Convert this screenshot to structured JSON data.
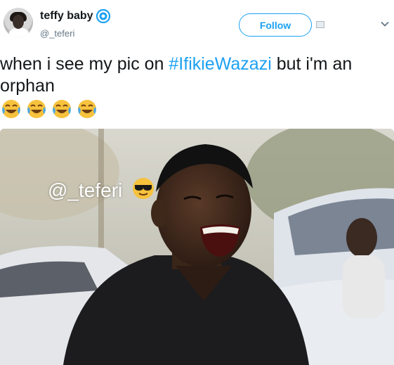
{
  "tweet": {
    "display_name": "teffy baby",
    "handle": "@_teferi",
    "verified": true,
    "follow_label": "Follow",
    "text_before": "when i see my pic on ",
    "hashtag": "#IfikieWazazi",
    "text_after": " but i'm an orphan",
    "emoji": [
      "face-with-tears-of-joy",
      "face-with-tears-of-joy",
      "face-with-tears-of-joy",
      "face-with-tears-of-joy"
    ]
  },
  "photo": {
    "watermark_text": "@_teferi",
    "watermark_emoji": "smiling-face-with-sunglasses",
    "description_icon": "laughing-man-photo"
  },
  "colors": {
    "accent": "#1da1f2",
    "text": "#14171a",
    "muted": "#657786"
  }
}
